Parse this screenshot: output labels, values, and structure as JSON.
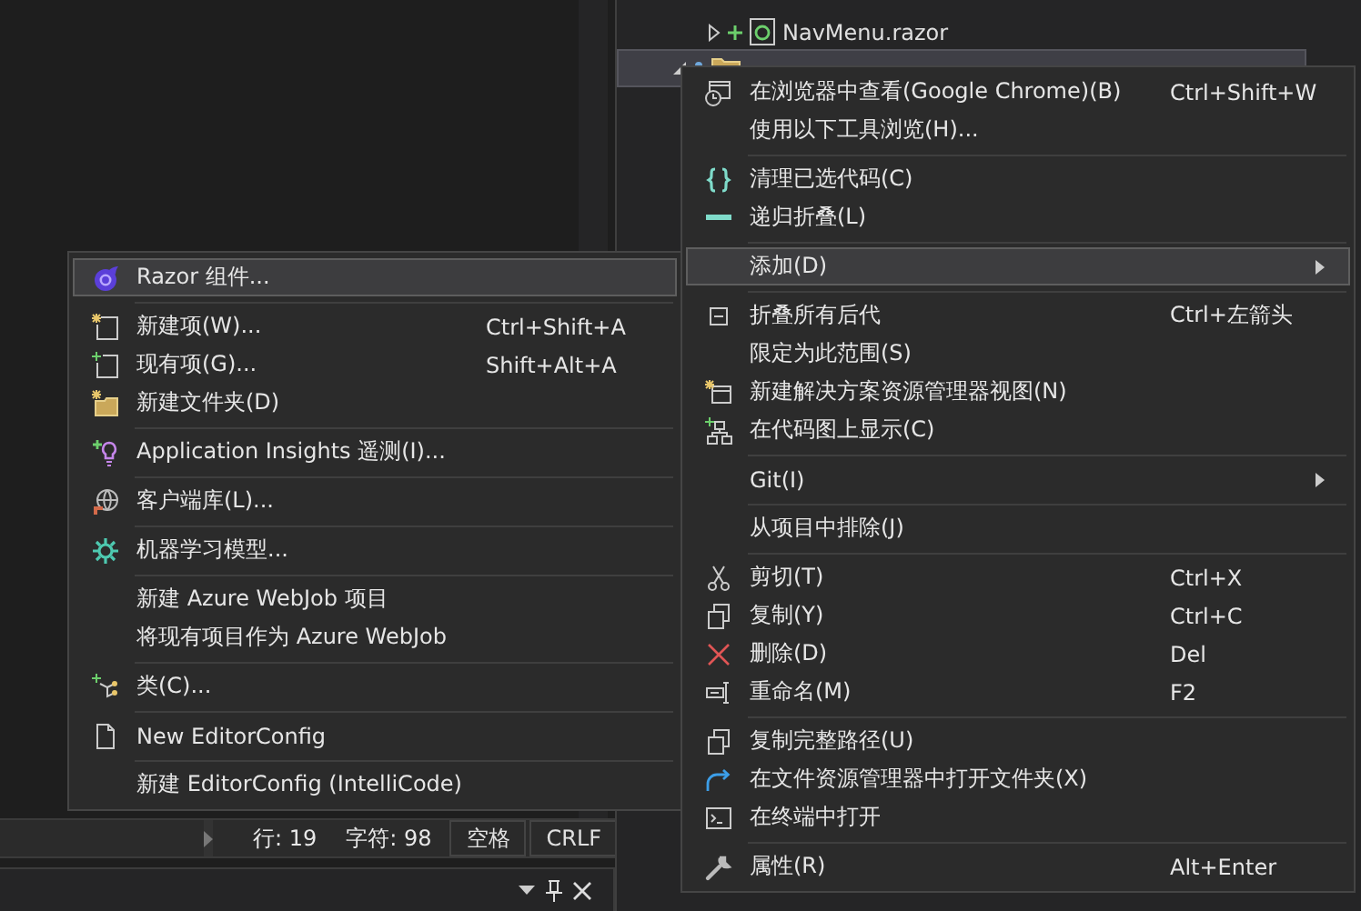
{
  "solution_explorer": {
    "items": [
      {
        "kind": "file",
        "label": "NavMenu.razor",
        "selected": false
      },
      {
        "kind": "folder",
        "selected": true
      }
    ]
  },
  "context_menu": {
    "items": [
      {
        "kind": "item",
        "label": "在浏览器中查看(Google Chrome)(B)",
        "shortcut": "Ctrl+Shift+W",
        "selected": false
      },
      {
        "kind": "item",
        "label": "使用以下工具浏览(H)...",
        "selected": false
      },
      {
        "kind": "separator"
      },
      {
        "kind": "item",
        "label": "清理已选代码(C)",
        "selected": false
      },
      {
        "kind": "item",
        "label": "递归折叠(L)",
        "selected": false
      },
      {
        "kind": "separator"
      },
      {
        "kind": "item",
        "label": "添加(D)",
        "submenu": true,
        "selected": true
      },
      {
        "kind": "separator"
      },
      {
        "kind": "item",
        "label": "折叠所有后代",
        "shortcut": "Ctrl+左箭头",
        "selected": false
      },
      {
        "kind": "item",
        "label": "限定为此范围(S)",
        "selected": false
      },
      {
        "kind": "item",
        "label": "新建解决方案资源管理器视图(N)",
        "selected": false
      },
      {
        "kind": "item",
        "label": "在代码图上显示(C)",
        "selected": false
      },
      {
        "kind": "separator"
      },
      {
        "kind": "item",
        "label": "Git(I)",
        "submenu": true,
        "selected": false
      },
      {
        "kind": "separator"
      },
      {
        "kind": "item",
        "label": "从项目中排除(J)",
        "selected": false
      },
      {
        "kind": "separator"
      },
      {
        "kind": "item",
        "label": "剪切(T)",
        "shortcut": "Ctrl+X",
        "selected": false
      },
      {
        "kind": "item",
        "label": "复制(Y)",
        "shortcut": "Ctrl+C",
        "selected": false
      },
      {
        "kind": "item",
        "label": "删除(D)",
        "shortcut": "Del",
        "selected": false
      },
      {
        "kind": "item",
        "label": "重命名(M)",
        "shortcut": "F2",
        "selected": false
      },
      {
        "kind": "separator"
      },
      {
        "kind": "item",
        "label": "复制完整路径(U)",
        "selected": false
      },
      {
        "kind": "item",
        "label": "在文件资源管理器中打开文件夹(X)",
        "selected": false
      },
      {
        "kind": "item",
        "label": "在终端中打开",
        "selected": false
      },
      {
        "kind": "separator"
      },
      {
        "kind": "item",
        "label": "属性(R)",
        "shortcut": "Alt+Enter",
        "selected": false
      }
    ]
  },
  "add_submenu": {
    "items": [
      {
        "kind": "item",
        "label": "Razor 组件...",
        "selected": true
      },
      {
        "kind": "separator"
      },
      {
        "kind": "item",
        "label": "新建项(W)...",
        "shortcut": "Ctrl+Shift+A",
        "selected": false
      },
      {
        "kind": "item",
        "label": "现有项(G)...",
        "shortcut": "Shift+Alt+A",
        "selected": false
      },
      {
        "kind": "item",
        "label": "新建文件夹(D)",
        "selected": false
      },
      {
        "kind": "separator"
      },
      {
        "kind": "item",
        "label": "Application Insights 遥测(I)...",
        "selected": false
      },
      {
        "kind": "separator"
      },
      {
        "kind": "item",
        "label": "客户端库(L)...",
        "selected": false
      },
      {
        "kind": "separator"
      },
      {
        "kind": "item",
        "label": "机器学习模型...",
        "selected": false
      },
      {
        "kind": "separator"
      },
      {
        "kind": "item",
        "label": "新建 Azure WebJob 项目",
        "selected": false
      },
      {
        "kind": "item",
        "label": "将现有项目作为 Azure WebJob",
        "selected": false
      },
      {
        "kind": "separator"
      },
      {
        "kind": "item",
        "label": "类(C)...",
        "selected": false
      },
      {
        "kind": "separator"
      },
      {
        "kind": "item",
        "label": "New EditorConfig",
        "selected": false
      },
      {
        "kind": "separator"
      },
      {
        "kind": "item",
        "label": "新建 EditorConfig (IntelliCode)",
        "selected": false
      }
    ]
  },
  "status_bar": {
    "line": "行: 19",
    "column": "字符: 98",
    "indent": "空格",
    "line_ending": "CRLF"
  }
}
